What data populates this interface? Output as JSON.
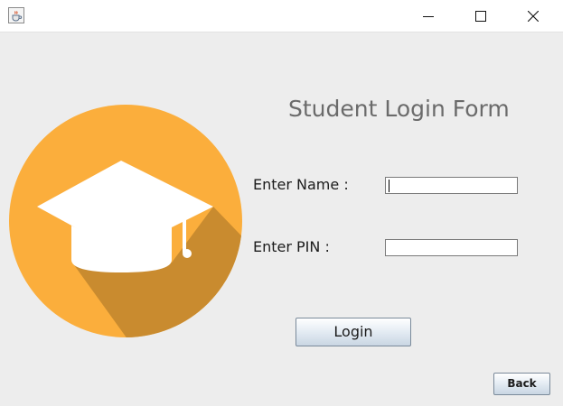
{
  "window": {
    "app_icon": "java-coffee-cup-icon",
    "controls": [
      "minimize-icon",
      "maximize-icon",
      "close-icon"
    ]
  },
  "form": {
    "title": "Student Login Form",
    "name_label": "Enter Name :",
    "name_value": "",
    "pin_label": "Enter PIN :",
    "pin_value": "",
    "login_label": "Login",
    "back_label": "Back"
  },
  "logo": {
    "icon": "graduation-cap-icon",
    "circle_color": "#fbae3c",
    "shadow_color": "#c98b2f",
    "cap_color": "#ffffff"
  }
}
